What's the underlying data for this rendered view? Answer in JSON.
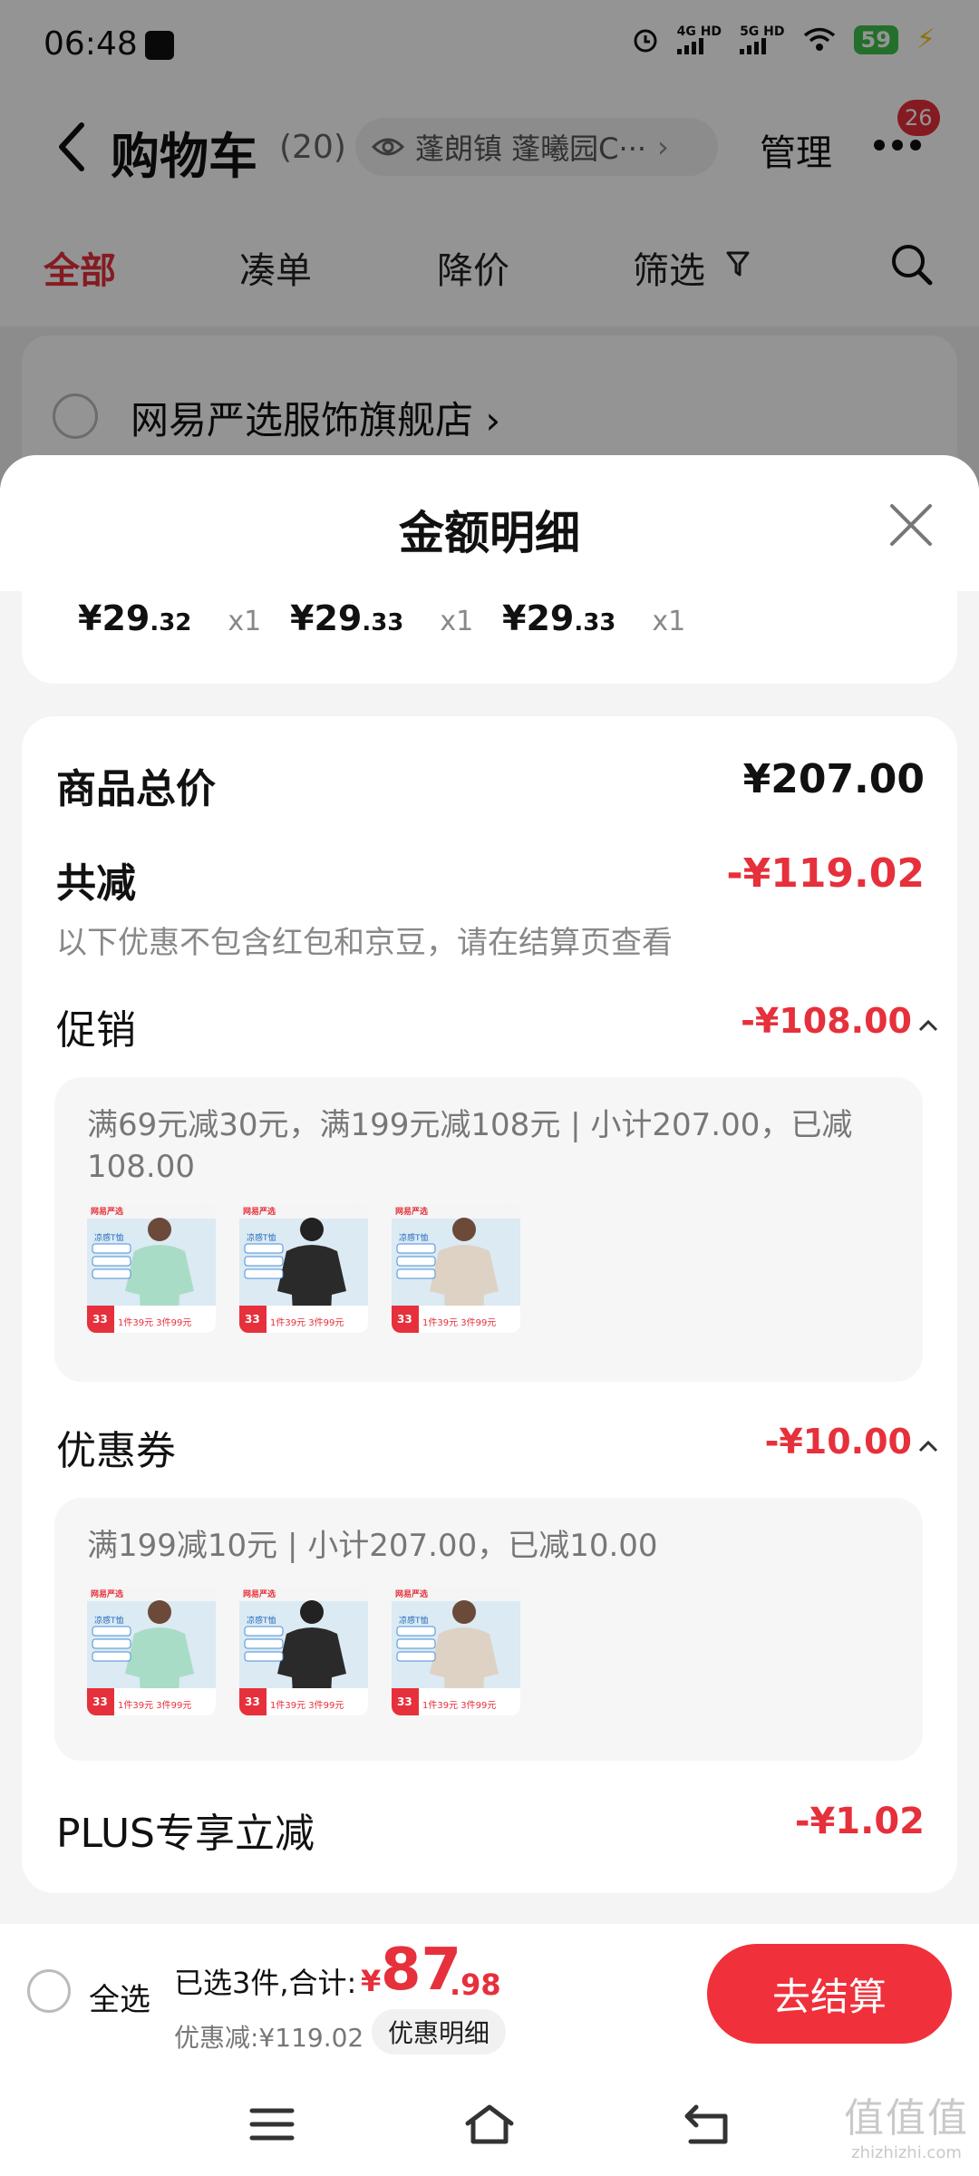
{
  "status": {
    "time": "06:48",
    "net1_top": "4G HD",
    "net2_top": "5G HD",
    "battery": "59"
  },
  "header": {
    "title": "购物车",
    "count": "(20)",
    "location": "蓬朗镇 蓬曦园C···",
    "manage": "管理",
    "badge": "26"
  },
  "tabs": [
    "全部",
    "凑单",
    "降价",
    "筛选"
  ],
  "shop": {
    "name": "网易严选服饰旗舰店 ›"
  },
  "sheet": {
    "title": "金额明细",
    "items": [
      {
        "int": "¥29",
        "dec": ".32",
        "qty": "x1"
      },
      {
        "int": "¥29",
        "dec": ".33",
        "qty": "x1"
      },
      {
        "int": "¥29",
        "dec": ".33",
        "qty": "x1"
      }
    ],
    "total_label": "商品总价",
    "total_value": "¥207.00",
    "reduce_label": "共减",
    "reduce_value": "-¥119.02",
    "note": "以下优惠不包含红包和京豆，请在结算页查看",
    "promo_label": "促销",
    "promo_value": "-¥108.00",
    "promo_detail": "满69元减30元，满199元减108元 | 小计207.00，已减108.00",
    "coupon_label": "优惠券",
    "coupon_value": "-¥10.00",
    "coupon_detail": "满199减10元 | 小计207.00，已减10.00",
    "plus_label": "PLUS专享立减",
    "plus_value": "-¥1.02"
  },
  "thumb_text": {
    "brand": "网易严选",
    "tag": "凉感T恤",
    "price": "33",
    "deal": "1件39元 3件99元"
  },
  "thumb_colors": [
    "#a9dcc6",
    "#2a2a2a",
    "#ddd2c4"
  ],
  "bottom": {
    "select_all": "全选",
    "selected": "已选3件,合计:",
    "yen": "¥",
    "total_int": "87",
    "total_dec": ".98",
    "discount": "优惠减:¥119.02",
    "detail_btn": "优惠明细",
    "checkout": "去结算"
  },
  "watermark": {
    "big": "值值值",
    "small": "zhizhizhi.com"
  },
  "colors": {
    "accent": "#e6303b",
    "checkout": "#f0303a"
  }
}
